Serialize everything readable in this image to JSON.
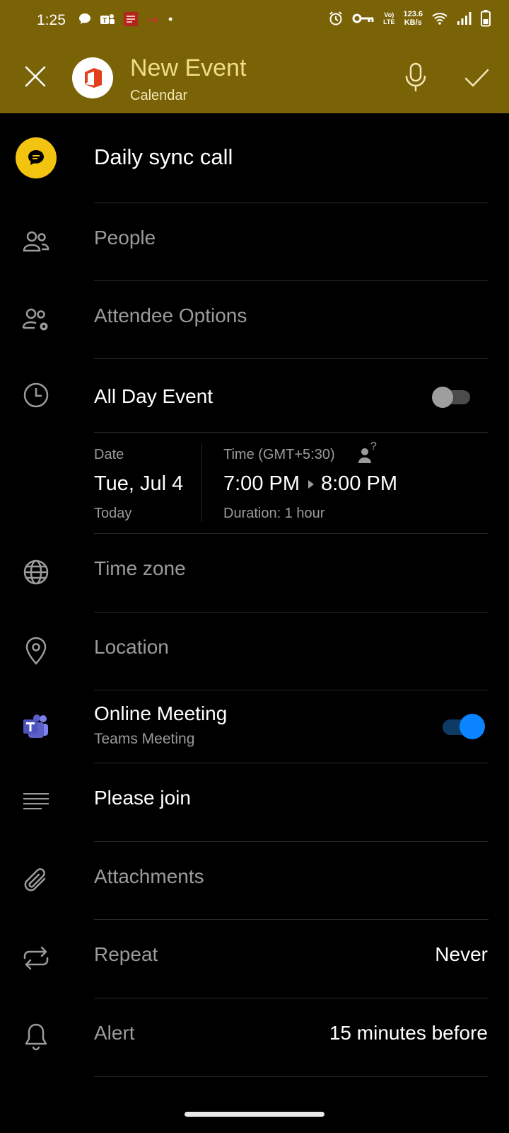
{
  "status_bar": {
    "time": "1:25",
    "net_speed_value": "123.6",
    "net_speed_unit": "KB/s",
    "volte_top": "Vo)",
    "volte_bottom": "LTE",
    "dot": "•"
  },
  "header": {
    "title": "New Event",
    "subtitle": "Calendar",
    "background_color": "#7a6206"
  },
  "event": {
    "title": "Daily sync call",
    "people_placeholder": "People",
    "attendee_options_label": "Attendee Options",
    "all_day_label": "All Day Event",
    "all_day_enabled": false,
    "date_label": "Date",
    "date_value": "Tue, Jul 4",
    "date_relative": "Today",
    "time_label": "Time (GMT+5:30)",
    "time_help_mark": "?",
    "start_time": "7:00 PM",
    "end_time": "8:00 PM",
    "duration": "Duration: 1 hour",
    "time_zone_label": "Time zone",
    "location_placeholder": "Location",
    "online_meeting_label": "Online Meeting",
    "online_meeting_provider": "Teams Meeting",
    "online_meeting_enabled": true,
    "description": "Please join",
    "attachments_label": "Attachments",
    "repeat_label": "Repeat",
    "repeat_value": "Never",
    "alert_label": "Alert",
    "alert_value": "15 minutes before"
  },
  "icons": [
    "close-icon",
    "office-logo",
    "microphone-icon",
    "check-icon",
    "chat-icon",
    "people-icon",
    "attendee-settings-icon",
    "clock-icon",
    "globe-icon",
    "location-pin-icon",
    "teams-icon",
    "text-lines-icon",
    "paperclip-icon",
    "repeat-icon",
    "bell-icon"
  ],
  "colors": {
    "accent_toggle": "#0a84ff",
    "avatar_yellow": "#f2c40f",
    "teams_purple": "#5b5fc7"
  }
}
